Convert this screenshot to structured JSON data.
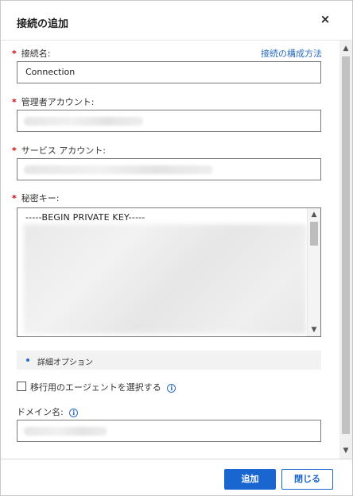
{
  "dialog": {
    "title": "接続の追加",
    "close_symbol": "×"
  },
  "form": {
    "connection_name": {
      "label": "接続名:",
      "value": "Connection",
      "help_link": "接続の構成方法"
    },
    "admin_account": {
      "label": "管理者アカウント:"
    },
    "service_account": {
      "label": "サービス アカウント:"
    },
    "secret_key": {
      "label": "秘密キー:",
      "first_line": "-----BEGIN PRIVATE KEY-----"
    },
    "advanced_options": {
      "label": "詳細オプション"
    },
    "select_agent": {
      "label": "移行用のエージェントを選択する",
      "checked": false
    },
    "domain_name": {
      "label": "ドメイン名:"
    },
    "required_marker": "*",
    "info_symbol": "i"
  },
  "footer": {
    "add_label": "追加",
    "close_label": "閉じる"
  },
  "icons": {
    "close": "close-icon",
    "info": "info-icon",
    "scroll_up": "chevron-up-icon",
    "scroll_down": "chevron-down-icon"
  },
  "colors": {
    "accent": "#1a66d1",
    "link": "#2a6cc2",
    "required": "#d10000"
  }
}
